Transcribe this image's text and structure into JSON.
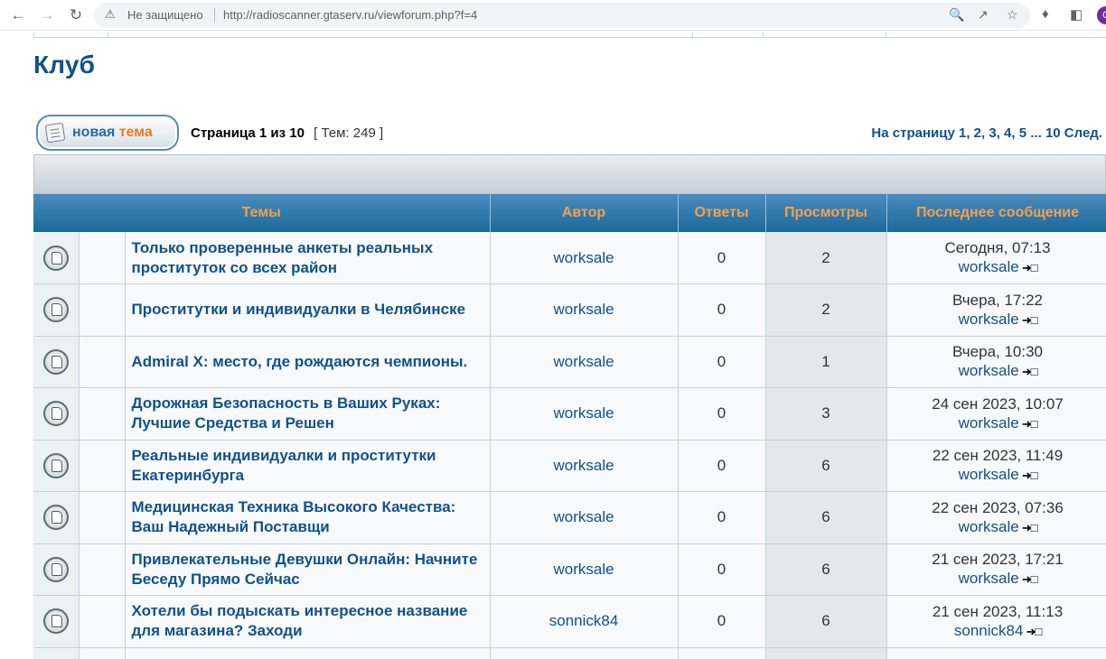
{
  "browser": {
    "security_text": "Не защищено",
    "url": "http://radioscanner.gtaserv.ru/viewforum.php?f=4",
    "profile_initial": "C"
  },
  "forum": {
    "title": "Клуб"
  },
  "toolbar": {
    "new_topic_part1": "новая ",
    "new_topic_part2": "тема",
    "page_label": "Страница",
    "page_current": "1",
    "page_of": "из",
    "page_total": "10",
    "topics_count": "[ Тем: 249 ]"
  },
  "pagination": {
    "label": "На страницу",
    "pages": [
      "1",
      "2",
      "3",
      "4",
      "5"
    ],
    "ellipsis": "...",
    "last": "10",
    "next": "След."
  },
  "table": {
    "headers": {
      "topics": "Темы",
      "author": "Автор",
      "replies": "Ответы",
      "views": "Просмотры",
      "last_post": "Последнее сообщение"
    },
    "rows": [
      {
        "title": "Только проверенные анкеты реальных проституток со всех район",
        "author": "worksale",
        "replies": "0",
        "views": "2",
        "last_time": "Сегодня, 07:13",
        "last_user": "worksale"
      },
      {
        "title": "Проститутки и индивидуалки в Челябинске",
        "author": "worksale",
        "replies": "0",
        "views": "2",
        "last_time": "Вчера, 17:22",
        "last_user": "worksale"
      },
      {
        "title": "Admiral X: место, где рождаются чемпионы.",
        "author": "worksale",
        "replies": "0",
        "views": "1",
        "last_time": "Вчера, 10:30",
        "last_user": "worksale"
      },
      {
        "title": "Дорожная Безопасность в Ваших Руках: Лучшие Средства и Решен",
        "author": "worksale",
        "replies": "0",
        "views": "3",
        "last_time": "24 сен 2023, 10:07",
        "last_user": "worksale"
      },
      {
        "title": "Реальные индивидуалки и проститутки Екатеринбурга",
        "author": "worksale",
        "replies": "0",
        "views": "6",
        "last_time": "22 сен 2023, 11:49",
        "last_user": "worksale"
      },
      {
        "title": "Медицинская Техника Высокого Качества: Ваш Надежный Поставщи",
        "author": "worksale",
        "replies": "0",
        "views": "6",
        "last_time": "22 сен 2023, 07:36",
        "last_user": "worksale"
      },
      {
        "title": "Привлекательные Девушки Онлайн: Начните Беседу Прямо Сейчас",
        "author": "worksale",
        "replies": "0",
        "views": "6",
        "last_time": "21 сен 2023, 17:21",
        "last_user": "worksale"
      },
      {
        "title": "Хотели бы подыскать интересное название для магазина? Заходи",
        "author": "sonnick84",
        "replies": "0",
        "views": "6",
        "last_time": "21 сен 2023, 11:13",
        "last_user": "sonnick84"
      }
    ]
  }
}
